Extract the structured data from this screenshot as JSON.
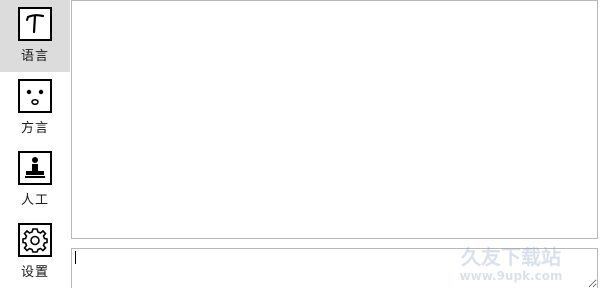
{
  "sidebar": {
    "items": [
      {
        "label": "语言",
        "icon": "text-t-icon",
        "active": true
      },
      {
        "label": "方言",
        "icon": "face-icon",
        "active": false
      },
      {
        "label": "人工",
        "icon": "person-desk-icon",
        "active": false
      },
      {
        "label": "设置",
        "icon": "gear-icon",
        "active": false
      }
    ]
  },
  "main": {
    "output_text": "",
    "input_value": ""
  },
  "watermark": {
    "line1": "久友下载站",
    "line2": "www.9upk.com"
  },
  "colors": {
    "active_bg": "#dcdcdc",
    "border": "#b8b8b8",
    "icon_stroke": "#000000"
  }
}
